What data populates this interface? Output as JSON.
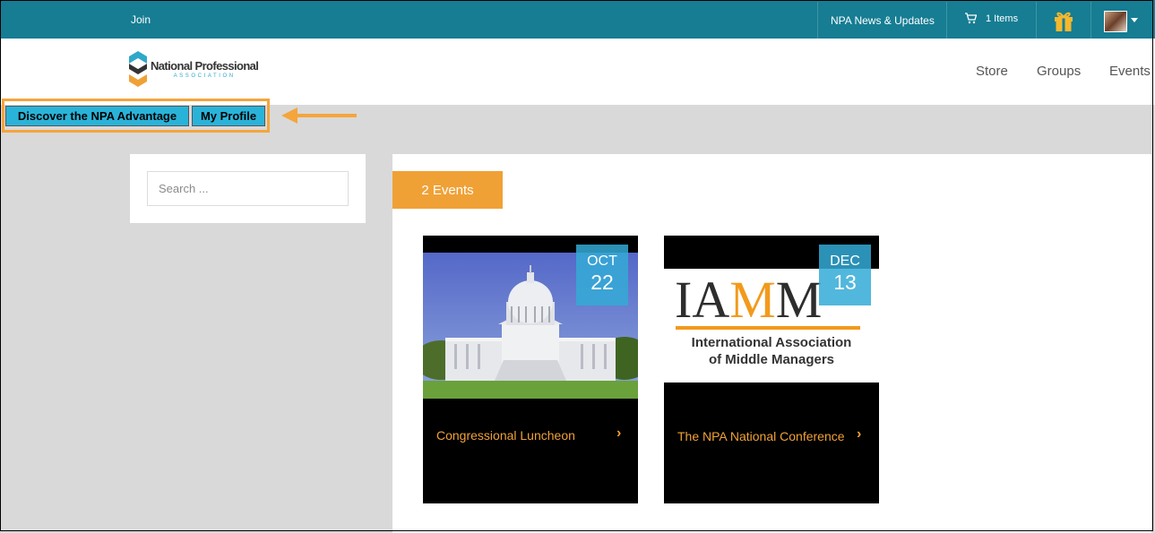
{
  "topbar": {
    "join": "Join",
    "news": "NPA News & Updates",
    "cart_count": "1 Items"
  },
  "logo": {
    "name": "National Professional",
    "sub": "ASSOCIATION"
  },
  "nav": {
    "items": [
      "Store",
      "Groups",
      "Events"
    ]
  },
  "overlay": {
    "discover": "Discover the NPA Advantage",
    "profile": "My Profile"
  },
  "search": {
    "placeholder": "Search ..."
  },
  "events": {
    "count_label": "2 Events",
    "items": [
      {
        "month": "OCT",
        "day": "22",
        "title": "Congressional Luncheon"
      },
      {
        "month": "DEC",
        "day": "13",
        "title": "The NPA National Conference"
      }
    ]
  },
  "iamm": {
    "logo_letters": "IAMM",
    "line1": "International Association",
    "line2": "of Middle Managers"
  },
  "colors": {
    "topbar": "#167d93",
    "accent": "#f0a136",
    "badge": "#34aad6",
    "button": "#2ab3d9"
  }
}
